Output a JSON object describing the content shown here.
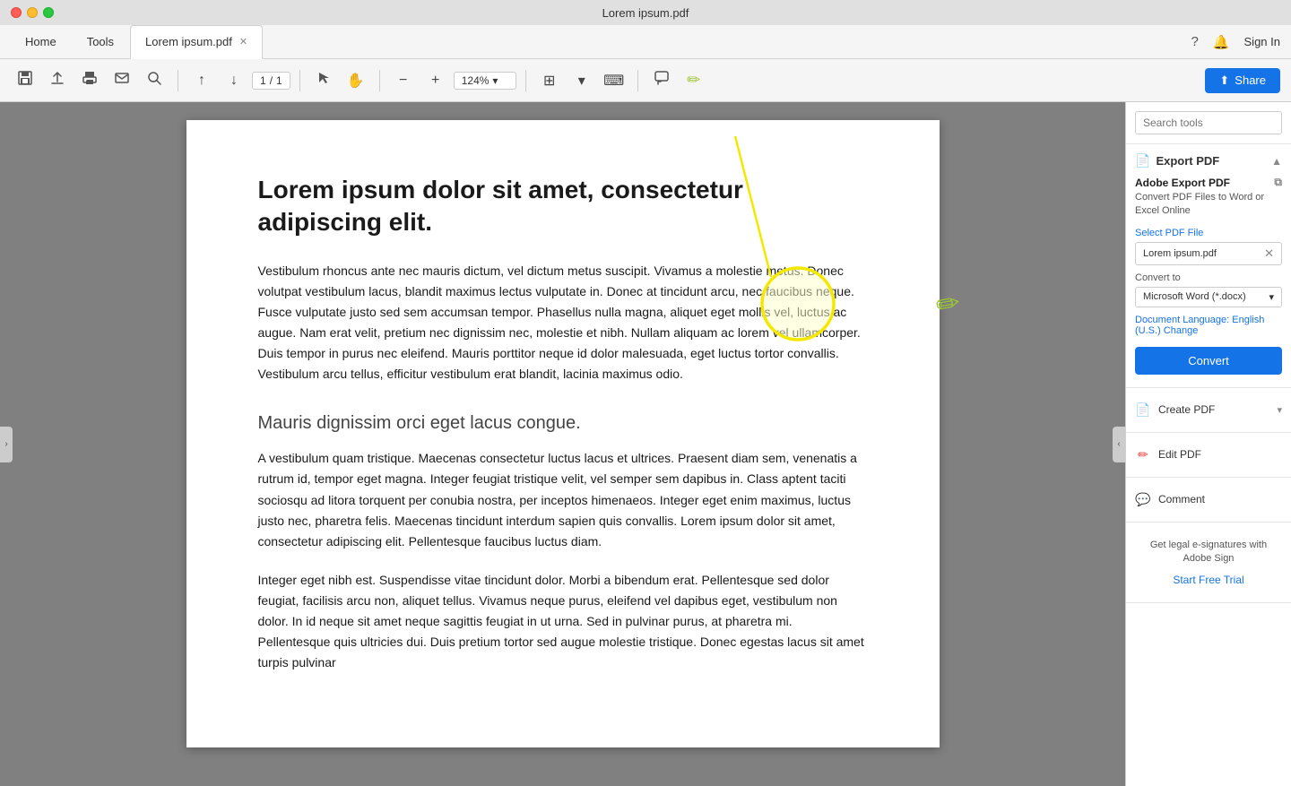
{
  "titleBar": {
    "title": "Lorem ipsum.pdf"
  },
  "menuBar": {
    "tabs": [
      {
        "id": "home",
        "label": "Home",
        "active": false
      },
      {
        "id": "tools",
        "label": "Tools",
        "active": false
      },
      {
        "id": "lorem",
        "label": "Lorem ipsum.pdf",
        "active": true,
        "closeable": true
      }
    ],
    "right": {
      "help": "?",
      "bell": "🔔",
      "signin": "Sign In"
    }
  },
  "toolbar": {
    "save_label": "💾",
    "upload_label": "⬆",
    "print_label": "🖨",
    "email_label": "✉",
    "search_label": "🔍",
    "prev_page": "↑",
    "next_page": "↓",
    "page_current": "1",
    "page_total": "1",
    "select_label": "↖",
    "hand_label": "✋",
    "zoom_out": "−",
    "zoom_in": "+",
    "zoom_level": "124%",
    "marque_label": "⊞",
    "keyboard_label": "⌨",
    "comment_label": "💬",
    "pencil_label": "✏",
    "share_label": "Share"
  },
  "pdf": {
    "heading1": "Lorem ipsum dolor sit amet, consectetur adipiscing elit.",
    "paragraph1": "Vestibulum rhoncus ante nec mauris dictum, vel dictum metus suscipit. Vivamus a molestie metus. Donec volutpat vestibulum lacus, blandit maximus lectus vulputate in. Donec at tincidunt arcu, nec faucibus neque. Fusce vulputate justo sed sem accumsan tempor. Phasellus nulla magna, aliquet eget mollis vel, luctus ac augue. Nam erat velit, pretium nec dignissim nec, molestie et nibh. Nullam aliquam ac lorem vel ullamcorper. Duis tempor in purus nec eleifend. Mauris porttitor neque id dolor malesuada, eget luctus tortor convallis. Vestibulum arcu tellus, efficitur vestibulum erat blandit, lacinia maximus odio.",
    "heading2": "Mauris dignissim orci eget lacus congue.",
    "paragraph2": "A vestibulum quam tristique. Maecenas consectetur luctus lacus et ultrices. Praesent diam sem, venenatis a rutrum id, tempor eget magna. Integer feugiat tristique velit, vel semper sem dapibus in. Class aptent taciti sociosqu ad litora torquent per conubia nostra, per inceptos himenaeos. Integer eget enim maximus, luctus justo nec, pharetra felis. Maecenas tincidunt interdum sapien quis convallis. Lorem ipsum dolor sit amet, consectetur adipiscing elit. Pellentesque faucibus luctus diam.",
    "paragraph3": "Integer eget nibh est. Suspendisse vitae tincidunt dolor. Morbi a bibendum erat. Pellentesque sed dolor feugiat, facilisis arcu non, aliquet tellus. Vivamus neque purus, eleifend vel dapibus eget, vestibulum non dolor. In id neque sit amet neque sagittis feugiat in ut urna. Sed in pulvinar purus, at pharetra mi. Pellentesque quis ultricies dui. Duis pretium tortor sed augue molestie tristique. Donec egestas lacus sit amet turpis pulvinar"
  },
  "rightPanel": {
    "search_placeholder": "Search tools",
    "exportPDF": {
      "title": "Export PDF",
      "sectionTitle": "Adobe Export PDF",
      "sectionDesc": "Convert PDF Files to Word or Excel Online",
      "selectPdfLabel": "Select PDF File",
      "pdfFileName": "Lorem ipsum.pdf",
      "convertToLabel": "Convert to",
      "convertToValue": "Microsoft Word (*.docx)",
      "docLangLabel": "Document Language:",
      "docLangValue": "English (U.S.)",
      "changeLinkLabel": "Change",
      "convertBtnLabel": "Convert"
    },
    "tools": [
      {
        "id": "create-pdf",
        "label": "Create PDF",
        "icon": "📄",
        "hasArrow": true
      },
      {
        "id": "edit-pdf",
        "label": "Edit PDF",
        "icon": "✏",
        "hasArrow": false
      },
      {
        "id": "comment",
        "label": "Comment",
        "icon": "💬",
        "hasArrow": false
      }
    ],
    "adobeSign": {
      "text": "Get legal e-signatures with Adobe Sign",
      "startFreeTrial": "Start Free Trial"
    }
  },
  "annotation": {
    "pencil": "✏"
  }
}
